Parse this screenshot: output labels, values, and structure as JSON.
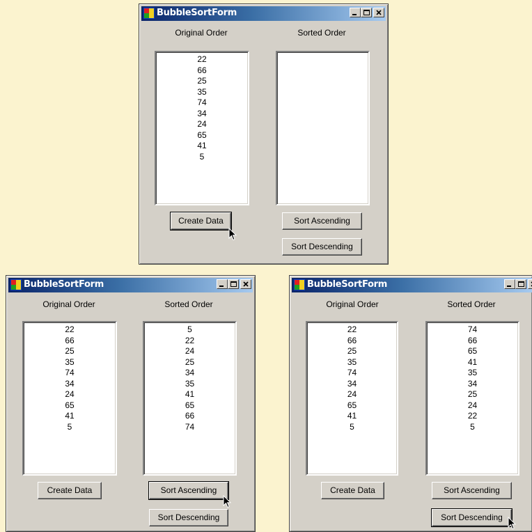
{
  "windows": [
    {
      "title": "BubbleSortForm",
      "original_label": "Original Order",
      "sorted_label": "Sorted Order",
      "original_items": [
        "22",
        "66",
        "25",
        "35",
        "74",
        "34",
        "24",
        "65",
        "41",
        "5"
      ],
      "sorted_items": [],
      "create_label": "Create Data",
      "ascending_label": "Sort Ascending",
      "descending_label": "Sort Descending"
    },
    {
      "title": "BubbleSortForm",
      "original_label": "Original Order",
      "sorted_label": "Sorted Order",
      "original_items": [
        "22",
        "66",
        "25",
        "35",
        "74",
        "34",
        "24",
        "65",
        "41",
        "5"
      ],
      "sorted_items": [
        "5",
        "22",
        "24",
        "25",
        "34",
        "35",
        "41",
        "65",
        "66",
        "74"
      ],
      "create_label": "Create Data",
      "ascending_label": "Sort Ascending",
      "descending_label": "Sort Descending"
    },
    {
      "title": "BubbleSortForm",
      "original_label": "Original Order",
      "sorted_label": "Sorted Order",
      "original_items": [
        "22",
        "66",
        "25",
        "35",
        "74",
        "34",
        "24",
        "65",
        "41",
        "5"
      ],
      "sorted_items": [
        "74",
        "66",
        "65",
        "41",
        "35",
        "34",
        "25",
        "24",
        "22",
        "5"
      ],
      "create_label": "Create Data",
      "ascending_label": "Sort Ascending",
      "descending_label": "Sort Descending"
    }
  ],
  "icons": {
    "app": "windows-form-icon",
    "minimize": "minimize-icon",
    "maximize": "maximize-icon",
    "close": "close-icon",
    "cursor": "mouse-pointer-icon"
  },
  "colors": {
    "background": "#fbf3cf",
    "window": "#d4d0c8",
    "titlebar_start": "#0a246a",
    "titlebar_end": "#a6caf0"
  }
}
